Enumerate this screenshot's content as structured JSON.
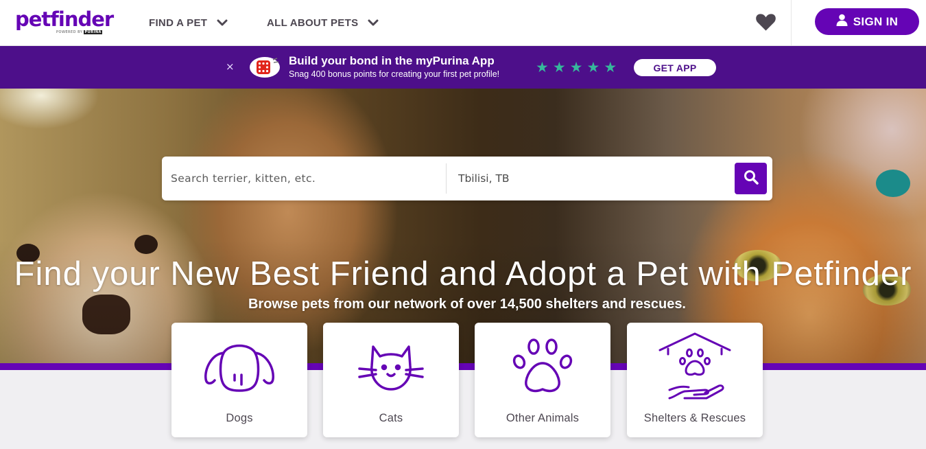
{
  "logo": {
    "text": "petfinder",
    "tagline_prefix": "POWERED BY",
    "tagline_brand": "PURINA"
  },
  "nav": {
    "items": [
      {
        "label": "FIND A PET",
        "icon": "chevron-down-icon"
      },
      {
        "label": "ALL ABOUT PETS",
        "icon": "chevron-down-icon"
      }
    ],
    "favorites_icon": "heart-icon",
    "signin_label": "SIGN IN",
    "signin_icon": "user-icon"
  },
  "banner": {
    "close_glyph": "×",
    "app_icon": "purina-app-icon",
    "title": "Build your bond in the myPurina App",
    "subtitle": "Snag 400 bonus points for creating your first pet profile!",
    "rating_stars": 5,
    "cta_label": "GET APP"
  },
  "search": {
    "pet_placeholder": "Search terrier, kitten, etc.",
    "location_value": "Tbilisi, TB",
    "submit_icon": "search-icon"
  },
  "hero": {
    "headline": "Find your New Best Friend and Adopt a Pet with Petfinder",
    "subheadline": "Browse pets from our network of over 14,500 shelters and rescues."
  },
  "categories": [
    {
      "label": "Dogs",
      "icon": "dog-icon"
    },
    {
      "label": "Cats",
      "icon": "cat-icon"
    },
    {
      "label": "Other Animals",
      "icon": "paw-icon"
    },
    {
      "label": "Shelters & Rescues",
      "icon": "shelter-icon"
    }
  ],
  "colors": {
    "brand_purple": "#6504b5",
    "banner_purple": "#4d0f8a",
    "star_teal": "#36b79c",
    "nav_text": "#4d4751"
  }
}
